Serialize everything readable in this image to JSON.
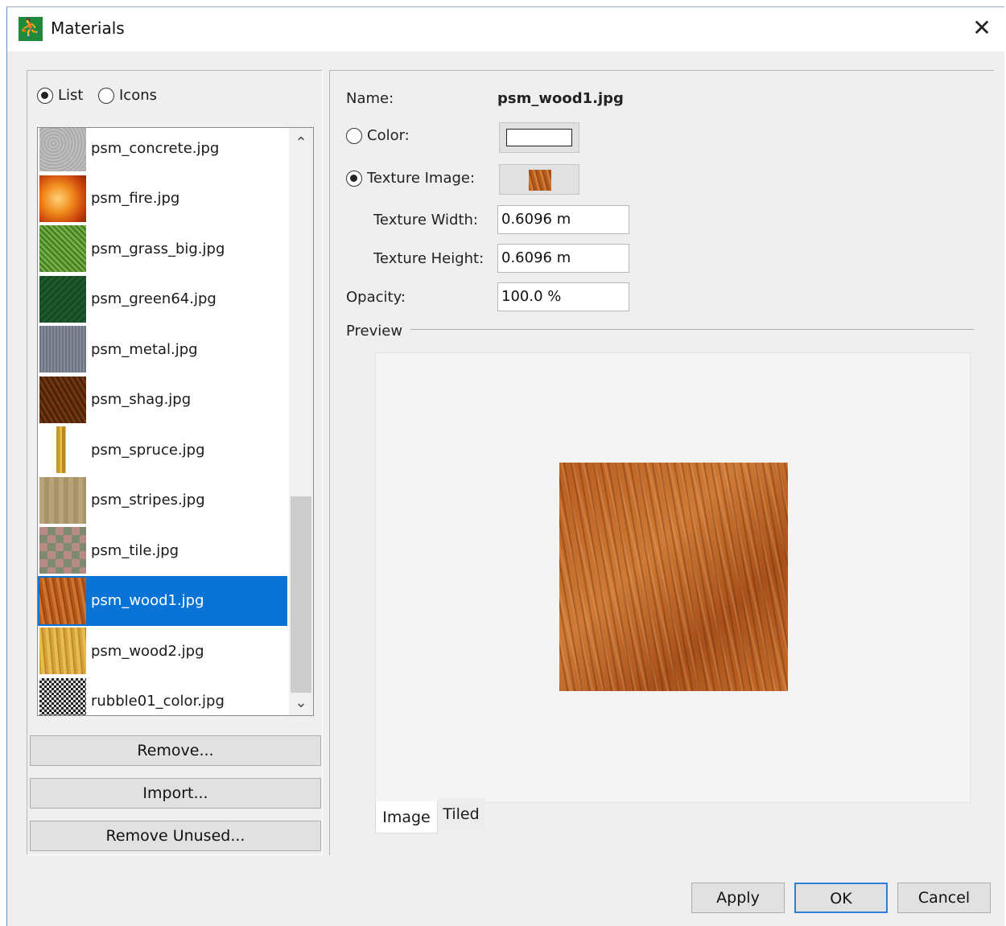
{
  "window": {
    "title": "Materials",
    "close_glyph": "✕"
  },
  "view_mode": {
    "options": [
      {
        "label": "List",
        "selected": true
      },
      {
        "label": "Icons",
        "selected": false
      }
    ]
  },
  "materials": {
    "items": [
      {
        "label": "psm_concrete.jpg",
        "thumb": "concrete"
      },
      {
        "label": "psm_fire.jpg",
        "thumb": "fire"
      },
      {
        "label": "psm_grass_big.jpg",
        "thumb": "grass"
      },
      {
        "label": "psm_green64.jpg",
        "thumb": "green"
      },
      {
        "label": "psm_metal.jpg",
        "thumb": "metal"
      },
      {
        "label": "psm_shag.jpg",
        "thumb": "shag"
      },
      {
        "label": "psm_spruce.jpg",
        "thumb": "spruce"
      },
      {
        "label": "psm_stripes.jpg",
        "thumb": "stripes"
      },
      {
        "label": "psm_tile.jpg",
        "thumb": "tile"
      },
      {
        "label": "psm_wood1.jpg",
        "thumb": "wood1",
        "selected": true
      },
      {
        "label": "psm_wood2.jpg",
        "thumb": "wood2"
      },
      {
        "label": "rubble01_color.jpg",
        "thumb": "rubble"
      }
    ],
    "selected_color": "#0a74d6"
  },
  "left_buttons": {
    "remove": "Remove...",
    "import": "Import...",
    "remove_unused": "Remove Unused..."
  },
  "details": {
    "name_label": "Name:",
    "name_value": "psm_wood1.jpg",
    "color_label": "Color:",
    "texture_label": "Texture Image:",
    "texture_width_label": "Texture Width:",
    "texture_width_value": "0.6096 m",
    "texture_height_label": "Texture Height:",
    "texture_height_value": "0.6096 m",
    "opacity_label": "Opacity:",
    "opacity_value": "100.0 %",
    "preview_label": "Preview",
    "mode": "texture"
  },
  "preview_tabs": [
    {
      "label": "Image",
      "active": true
    },
    {
      "label": "Tiled",
      "active": false
    }
  ],
  "dialog_buttons": {
    "apply": "Apply",
    "ok": "OK",
    "cancel": "Cancel"
  }
}
